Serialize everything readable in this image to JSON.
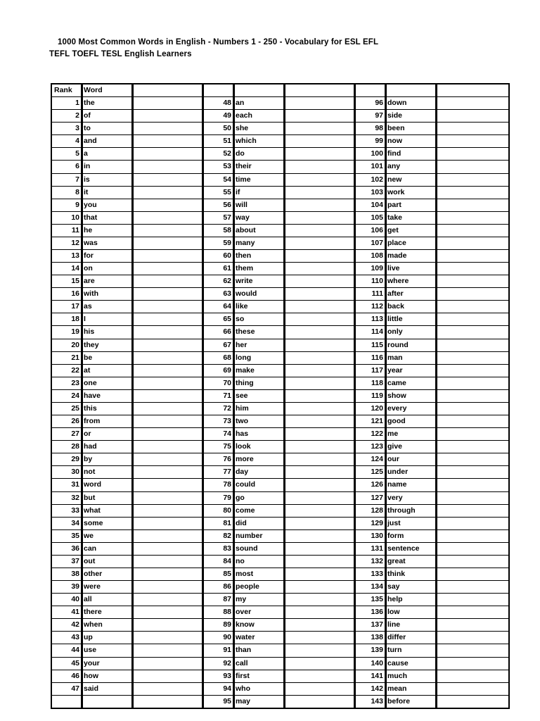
{
  "document": {
    "title_line1": "1000 Most Common Words in English - Numbers 1 - 250 - Vocabulary for ESL EFL",
    "title_line2": "TEFL TOEFL TESL English Learners"
  },
  "table": {
    "headers": {
      "rank": "Rank",
      "word": "Word",
      "blank": ""
    },
    "rows": [
      {
        "g1_rank": "1",
        "g1_word": "the",
        "g2_rank": "48",
        "g2_word": "an",
        "g3_rank": "96",
        "g3_word": "down"
      },
      {
        "g1_rank": "2",
        "g1_word": "of",
        "g2_rank": "49",
        "g2_word": "each",
        "g3_rank": "97",
        "g3_word": "side"
      },
      {
        "g1_rank": "3",
        "g1_word": "to",
        "g2_rank": "50",
        "g2_word": "she",
        "g3_rank": "98",
        "g3_word": "been"
      },
      {
        "g1_rank": "4",
        "g1_word": "and",
        "g2_rank": "51",
        "g2_word": "which",
        "g3_rank": "99",
        "g3_word": "now"
      },
      {
        "g1_rank": "5",
        "g1_word": "a",
        "g2_rank": "52",
        "g2_word": "do",
        "g3_rank": "100",
        "g3_word": "find"
      },
      {
        "g1_rank": "6",
        "g1_word": "in",
        "g2_rank": "53",
        "g2_word": "their",
        "g3_rank": "101",
        "g3_word": "any"
      },
      {
        "g1_rank": "7",
        "g1_word": "is",
        "g2_rank": "54",
        "g2_word": "time",
        "g3_rank": "102",
        "g3_word": "new"
      },
      {
        "g1_rank": "8",
        "g1_word": "it",
        "g2_rank": "55",
        "g2_word": "if",
        "g3_rank": "103",
        "g3_word": "work"
      },
      {
        "g1_rank": "9",
        "g1_word": "you",
        "g2_rank": "56",
        "g2_word": "will",
        "g3_rank": "104",
        "g3_word": "part"
      },
      {
        "g1_rank": "10",
        "g1_word": "that",
        "g2_rank": "57",
        "g2_word": "way",
        "g3_rank": "105",
        "g3_word": "take"
      },
      {
        "g1_rank": "11",
        "g1_word": "he",
        "g2_rank": "58",
        "g2_word": "about",
        "g3_rank": "106",
        "g3_word": "get"
      },
      {
        "g1_rank": "12",
        "g1_word": "was",
        "g2_rank": "59",
        "g2_word": "many",
        "g3_rank": "107",
        "g3_word": "place"
      },
      {
        "g1_rank": "13",
        "g1_word": "for",
        "g2_rank": "60",
        "g2_word": "then",
        "g3_rank": "108",
        "g3_word": "made"
      },
      {
        "g1_rank": "14",
        "g1_word": "on",
        "g2_rank": "61",
        "g2_word": "them",
        "g3_rank": "109",
        "g3_word": "live"
      },
      {
        "g1_rank": "15",
        "g1_word": "are",
        "g2_rank": "62",
        "g2_word": "write",
        "g3_rank": "110",
        "g3_word": "where"
      },
      {
        "g1_rank": "16",
        "g1_word": "with",
        "g2_rank": "63",
        "g2_word": "would",
        "g3_rank": "111",
        "g3_word": "after"
      },
      {
        "g1_rank": "17",
        "g1_word": "as",
        "g2_rank": "64",
        "g2_word": "like",
        "g3_rank": "112",
        "g3_word": "back"
      },
      {
        "g1_rank": "18",
        "g1_word": "I",
        "g2_rank": "65",
        "g2_word": "so",
        "g3_rank": "113",
        "g3_word": "little"
      },
      {
        "g1_rank": "19",
        "g1_word": "his",
        "g2_rank": "66",
        "g2_word": "these",
        "g3_rank": "114",
        "g3_word": "only"
      },
      {
        "g1_rank": "20",
        "g1_word": "they",
        "g2_rank": "67",
        "g2_word": "her",
        "g3_rank": "115",
        "g3_word": "round"
      },
      {
        "g1_rank": "21",
        "g1_word": "be",
        "g2_rank": "68",
        "g2_word": "long",
        "g3_rank": "116",
        "g3_word": "man"
      },
      {
        "g1_rank": "22",
        "g1_word": "at",
        "g2_rank": "69",
        "g2_word": "make",
        "g3_rank": "117",
        "g3_word": "year"
      },
      {
        "g1_rank": "23",
        "g1_word": "one",
        "g2_rank": "70",
        "g2_word": "thing",
        "g3_rank": "118",
        "g3_word": "came"
      },
      {
        "g1_rank": "24",
        "g1_word": "have",
        "g2_rank": "71",
        "g2_word": "see",
        "g3_rank": "119",
        "g3_word": "show"
      },
      {
        "g1_rank": "25",
        "g1_word": "this",
        "g2_rank": "72",
        "g2_word": "him",
        "g3_rank": "120",
        "g3_word": "every"
      },
      {
        "g1_rank": "26",
        "g1_word": "from",
        "g2_rank": "73",
        "g2_word": "two",
        "g3_rank": "121",
        "g3_word": "good"
      },
      {
        "g1_rank": "27",
        "g1_word": "or",
        "g2_rank": "74",
        "g2_word": "has",
        "g3_rank": "122",
        "g3_word": "me"
      },
      {
        "g1_rank": "28",
        "g1_word": "had",
        "g2_rank": "75",
        "g2_word": "look",
        "g3_rank": "123",
        "g3_word": "give"
      },
      {
        "g1_rank": "29",
        "g1_word": "by",
        "g2_rank": "76",
        "g2_word": "more",
        "g3_rank": "124",
        "g3_word": "our"
      },
      {
        "g1_rank": "30",
        "g1_word": "not",
        "g2_rank": "77",
        "g2_word": "day",
        "g3_rank": "125",
        "g3_word": "under"
      },
      {
        "g1_rank": "31",
        "g1_word": "word",
        "g2_rank": "78",
        "g2_word": "could",
        "g3_rank": "126",
        "g3_word": "name"
      },
      {
        "g1_rank": "32",
        "g1_word": "but",
        "g2_rank": "79",
        "g2_word": "go",
        "g3_rank": "127",
        "g3_word": "very"
      },
      {
        "g1_rank": "33",
        "g1_word": "what",
        "g2_rank": "80",
        "g2_word": "come",
        "g3_rank": "128",
        "g3_word": "through"
      },
      {
        "g1_rank": "34",
        "g1_word": "some",
        "g2_rank": "81",
        "g2_word": "did",
        "g3_rank": "129",
        "g3_word": "just"
      },
      {
        "g1_rank": "35",
        "g1_word": "we",
        "g2_rank": "82",
        "g2_word": "number",
        "g3_rank": "130",
        "g3_word": "form"
      },
      {
        "g1_rank": "36",
        "g1_word": "can",
        "g2_rank": "83",
        "g2_word": "sound",
        "g3_rank": "131",
        "g3_word": "sentence"
      },
      {
        "g1_rank": "37",
        "g1_word": "out",
        "g2_rank": "84",
        "g2_word": "no",
        "g3_rank": "132",
        "g3_word": "great"
      },
      {
        "g1_rank": "38",
        "g1_word": "other",
        "g2_rank": "85",
        "g2_word": "most",
        "g3_rank": "133",
        "g3_word": "think"
      },
      {
        "g1_rank": "39",
        "g1_word": "were",
        "g2_rank": "86",
        "g2_word": "people",
        "g3_rank": "134",
        "g3_word": "say"
      },
      {
        "g1_rank": "40",
        "g1_word": "all",
        "g2_rank": "87",
        "g2_word": "my",
        "g3_rank": "135",
        "g3_word": "help"
      },
      {
        "g1_rank": "41",
        "g1_word": "there",
        "g2_rank": "88",
        "g2_word": "over",
        "g3_rank": "136",
        "g3_word": "low"
      },
      {
        "g1_rank": "42",
        "g1_word": "when",
        "g2_rank": "89",
        "g2_word": "know",
        "g3_rank": "137",
        "g3_word": "line"
      },
      {
        "g1_rank": "43",
        "g1_word": "up",
        "g2_rank": "90",
        "g2_word": "water",
        "g3_rank": "138",
        "g3_word": "differ"
      },
      {
        "g1_rank": "44",
        "g1_word": "use",
        "g2_rank": "91",
        "g2_word": "than",
        "g3_rank": "139",
        "g3_word": "turn"
      },
      {
        "g1_rank": "45",
        "g1_word": "your",
        "g2_rank": "92",
        "g2_word": "call",
        "g3_rank": "140",
        "g3_word": "cause"
      },
      {
        "g1_rank": "46",
        "g1_word": "how",
        "g2_rank": "93",
        "g2_word": "first",
        "g3_rank": "141",
        "g3_word": "much"
      },
      {
        "g1_rank": "47",
        "g1_word": "said",
        "g2_rank": "94",
        "g2_word": "who",
        "g3_rank": "142",
        "g3_word": "mean"
      },
      {
        "g1_rank": "",
        "g1_word": "",
        "g2_rank": "95",
        "g2_word": "may",
        "g3_rank": "143",
        "g3_word": "before"
      }
    ]
  }
}
